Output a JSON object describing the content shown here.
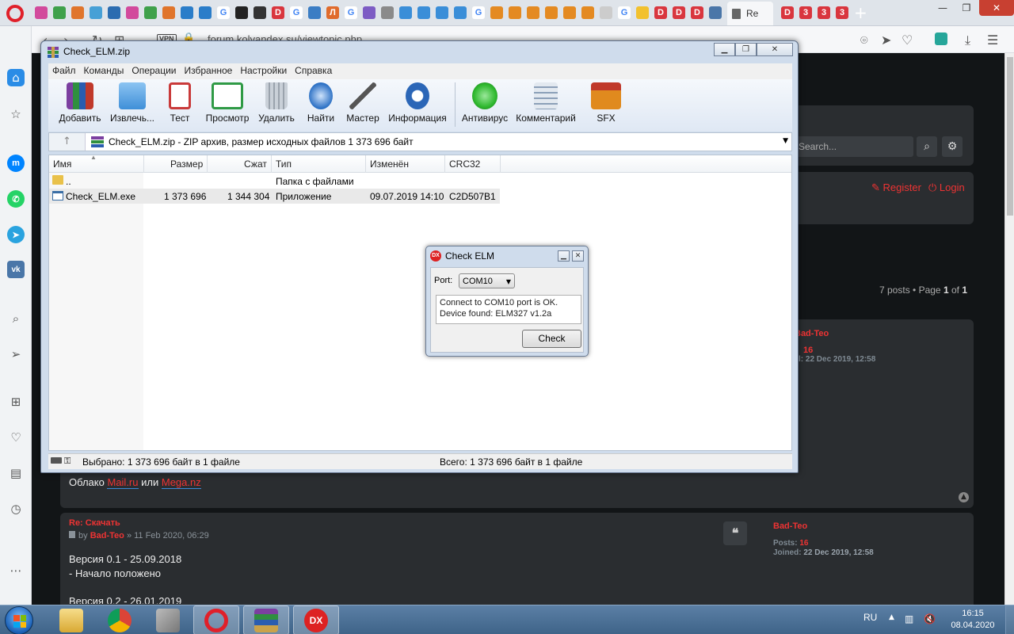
{
  "browser": {
    "active_tab_label": "Re",
    "url": "forum.kolyandex.su/viewtopic.php",
    "vpn_label": "VPN",
    "tab_letters": [
      "G",
      "D",
      "G",
      "Л",
      "G",
      "D",
      "D",
      "D",
      "3",
      "3",
      "3"
    ]
  },
  "forum": {
    "search_placeholder": "Search...",
    "register_label": "Register",
    "login_label": "Login",
    "posts_count": "7 posts",
    "page_label": "Page",
    "page_current": "1",
    "page_of": "of",
    "page_total": "1",
    "author1": "Bad-Teo",
    "author1_posts": "16",
    "author1_joined": "l: 22 Dec 2019, 12:58",
    "cloud_text_prefix": "Облако",
    "cloud_link1": "Mail.ru",
    "cloud_or": "или",
    "cloud_link2": "Mega.nz",
    "post2_title": "Re: Скачать",
    "post2_by": "by",
    "post2_author": "Bad-Teo",
    "post2_date": "» 11 Feb 2020, 06:29",
    "post2_line1": "Версия 0.1 - 25.09.2018",
    "post2_line2": "- Начало положено",
    "post2_line3": "Версия 0.2 - 26.01.2019",
    "author2": "Bad-Teo",
    "author2_posts_label": "Posts:",
    "author2_posts": "16",
    "author2_joined_label": "Joined:",
    "author2_joined": "22 Dec 2019, 12:58"
  },
  "winrar": {
    "title": "Check_ELM.zip",
    "menu": [
      "Файл",
      "Команды",
      "Операции",
      "Избранное",
      "Настройки",
      "Справка"
    ],
    "toolbar": [
      {
        "label": "Добавить",
        "icon": "add-archive-icon",
        "color": "#c0392b"
      },
      {
        "label": "Извлечь...",
        "icon": "extract-folder-icon",
        "color": "#3f8fd8"
      },
      {
        "label": "Тест",
        "icon": "test-clipboard-icon",
        "color": "#c93a3a"
      },
      {
        "label": "Просмотр",
        "icon": "view-book-icon",
        "color": "#2f9a45"
      },
      {
        "label": "Удалить",
        "icon": "delete-trash-icon",
        "color": "#9aa3ad"
      },
      {
        "label": "Найти",
        "icon": "find-magnifier-icon",
        "color": "#2a6fc4"
      },
      {
        "label": "Мастер",
        "icon": "wizard-wand-icon",
        "color": "#555555"
      },
      {
        "label": "Информация",
        "icon": "info-icon",
        "color": "#2b66b7"
      },
      {
        "label": "Антивирус",
        "icon": "antivirus-icon",
        "color": "#2eb82e"
      },
      {
        "label": "Комментарий",
        "icon": "comment-icon",
        "color": "#8ca0b8"
      },
      {
        "label": "SFX",
        "icon": "sfx-box-icon",
        "color": "#e08a1e"
      }
    ],
    "path_text": "Check_ELM.zip - ZIP архив, размер исходных файлов 1 373 696 байт",
    "columns": {
      "name": "Имя",
      "size": "Размер",
      "packed": "Сжат",
      "type": "Тип",
      "modified": "Изменён",
      "crc": "CRC32"
    },
    "rows": [
      {
        "name": "..",
        "size": "",
        "packed": "",
        "type": "Папка с файлами",
        "modified": "",
        "crc": ""
      },
      {
        "name": "Check_ELM.exe",
        "size": "1 373 696",
        "packed": "1 344 304",
        "type": "Приложение",
        "modified": "09.07.2019 14:10",
        "crc": "C2D507B1"
      }
    ],
    "status_selected": "Выбрано: 1 373 696 байт в 1 файле",
    "status_total": "Всего: 1 373 696 байт в 1 файле"
  },
  "checkelm": {
    "title": "Check ELM",
    "port_label": "Port:",
    "port_value": "COM10",
    "output_line1": "Connect to COM10 port is OK.",
    "output_line2": "Device found: ELM327 v1.2a",
    "check_label": "Check",
    "icon_text": "DX"
  },
  "taskbar": {
    "language": "RU",
    "time": "16:15",
    "date": "08.04.2020",
    "dx_label": "DX"
  }
}
